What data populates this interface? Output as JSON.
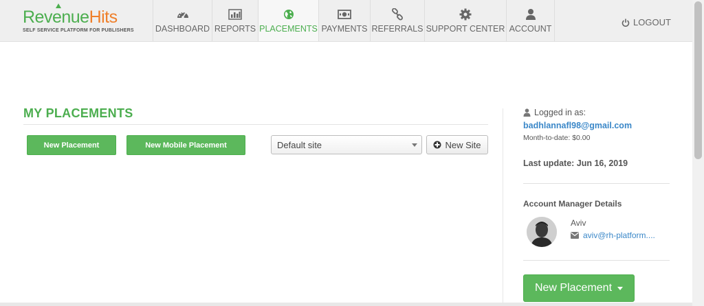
{
  "brand": {
    "name_part1": "Revenue",
    "name_part2": "Hits",
    "tagline": "SELF SERVICE PLATFORM FOR PUBLISHERS",
    "green": "#4cae4f",
    "orange": "#ef7f2a"
  },
  "nav": {
    "items": [
      {
        "label": "DASHBOARD",
        "icon": "speedometer-icon"
      },
      {
        "label": "REPORTS",
        "icon": "bar-chart-icon"
      },
      {
        "label": "PLACEMENTS",
        "icon": "globe-icon",
        "active": true
      },
      {
        "label": "PAYMENTS",
        "icon": "money-icon"
      },
      {
        "label": "REFERRALS",
        "icon": "link-icon"
      },
      {
        "label": "SUPPORT CENTER",
        "icon": "gear-icon"
      },
      {
        "label": "ACCOUNT",
        "icon": "user-icon"
      }
    ],
    "logout": "LOGOUT"
  },
  "main": {
    "title": "MY PLACEMENTS",
    "new_placement": "New Placement",
    "new_mobile_placement": "New Mobile Placement",
    "site_select": "Default site",
    "new_site": "New Site"
  },
  "sidebar": {
    "logged_in_label": "Logged in as:",
    "email": "badhlannafl98@gmail.com",
    "month_to_date": "Month-to-date:  $0.00",
    "last_update": "Last update: Jun 16, 2019",
    "account_manager_title": "Account Manager Details",
    "manager_name": "Aviv",
    "manager_email": "aviv@rh-platform....",
    "new_placement_button": "New Placement"
  }
}
